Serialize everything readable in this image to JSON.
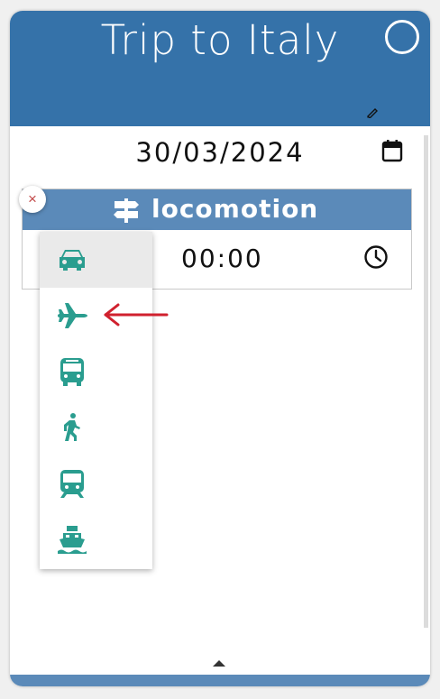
{
  "trip": {
    "title": "Trip to Italy"
  },
  "date": {
    "value": "30/03/2024"
  },
  "locomotion": {
    "title": "locomotion",
    "time": "00:00",
    "close_label": "×",
    "options": [
      {
        "icon": "car-icon",
        "selected": true
      },
      {
        "icon": "airplane-icon",
        "selected": false
      },
      {
        "icon": "bus-icon",
        "selected": false
      },
      {
        "icon": "walking-icon",
        "selected": false
      },
      {
        "icon": "train-icon",
        "selected": false
      },
      {
        "icon": "ship-icon",
        "selected": false
      }
    ]
  },
  "colors": {
    "header": "#3572a9",
    "section_header": "#5b8ab9",
    "icon_teal": "#2a9d8f",
    "arrow_red": "#d0212e",
    "close_red": "#c24a4a"
  }
}
